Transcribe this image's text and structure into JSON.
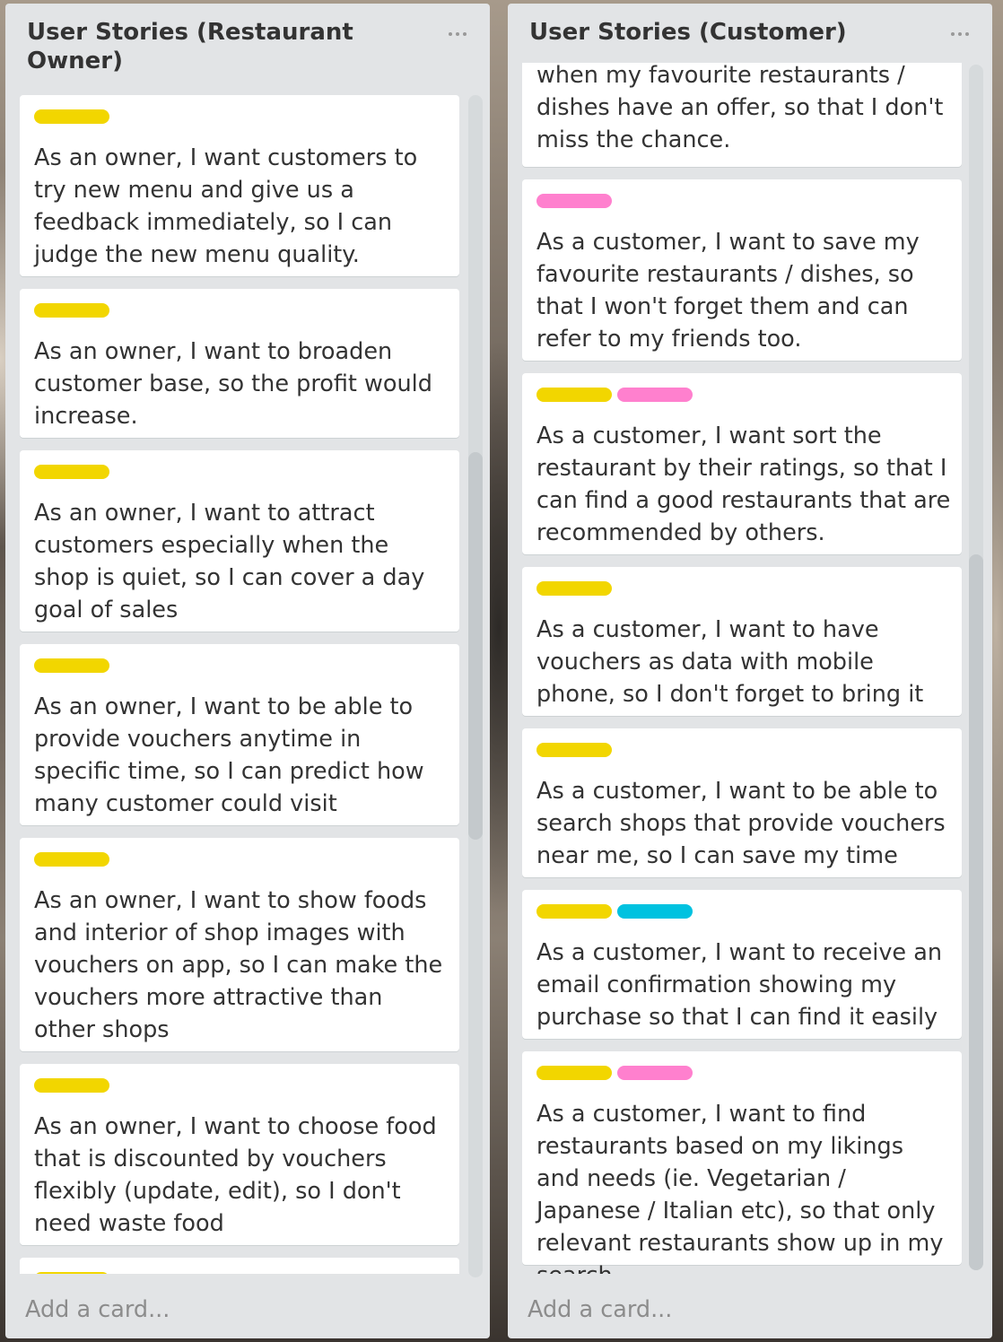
{
  "lists": [
    {
      "title": "User Stories (Restaurant Owner)",
      "add_card_label": "Add a card...",
      "cards": [
        {
          "labels": [
            "yellow"
          ],
          "text": "As an owner, I want customers to try new menu and give us a feedback immediately, so I can judge the new menu quality."
        },
        {
          "labels": [
            "yellow"
          ],
          "text": "As an owner, I want to broaden customer base, so the profit would increase."
        },
        {
          "labels": [
            "yellow"
          ],
          "text": "As an owner, I want to attract customers especially when the shop is quiet, so I can cover a day goal of sales"
        },
        {
          "labels": [
            "yellow"
          ],
          "text": "As an owner, I want to be able to provide vouchers anytime in specific time, so I can predict how many customer could visit"
        },
        {
          "labels": [
            "yellow"
          ],
          "text": "As an owner, I want to show foods and interior of shop images with vouchers on app, so I can make the vouchers more attractive than other shops"
        },
        {
          "labels": [
            "yellow"
          ],
          "text": "As an owner, I want to choose food that is discounted by vouchers flexibly (update, edit), so I don't need waste food"
        },
        {
          "labels": [
            "yellow"
          ],
          "text": ""
        }
      ]
    },
    {
      "title": "User Stories (Customer)",
      "add_card_label": "Add a card...",
      "cards": [
        {
          "labels": [],
          "text": "when my favourite restaurants / dishes have an offer, so that I don't miss the chance."
        },
        {
          "labels": [
            "pink"
          ],
          "text": "As a customer, I want to save my favourite restaurants / dishes, so that I won't forget them and can refer to my friends too."
        },
        {
          "labels": [
            "yellow",
            "pink"
          ],
          "text": "As a customer, I want sort the restaurant by their ratings, so that I can find a good restaurants that are recommended by others."
        },
        {
          "labels": [
            "yellow"
          ],
          "text": "As a customer, I want to have vouchers as data with mobile phone, so I don't forget to bring it"
        },
        {
          "labels": [
            "yellow"
          ],
          "text": "As a customer, I want to be able to search shops that provide vouchers near me, so I can save my time"
        },
        {
          "labels": [
            "yellow",
            "sky"
          ],
          "text": "As a customer, I want to receive an email confirmation showing my purchase so that I can find it easily"
        },
        {
          "labels": [
            "yellow",
            "pink"
          ],
          "text": "As a customer, I want to find restaurants based on my likings and needs (ie. Vegetarian / Japanese / Italian etc), so that only relevant restaurants show up in my search."
        }
      ]
    }
  ],
  "colors": {
    "yellow": "#f2d600",
    "pink": "#ff80ce",
    "sky": "#00c2e0"
  }
}
